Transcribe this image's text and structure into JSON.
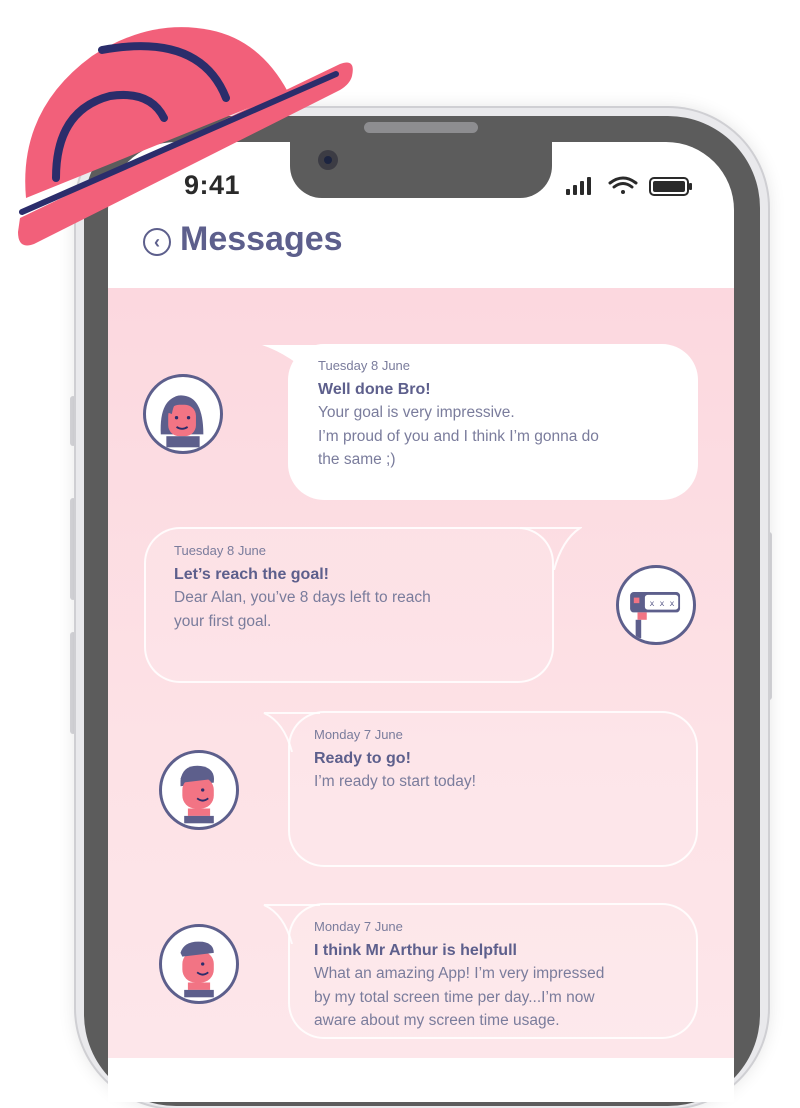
{
  "status_bar": {
    "time": "9:41"
  },
  "header": {
    "title": "Messages",
    "back_icon": "chevron-left-icon"
  },
  "colors": {
    "accent": "#5d5f8c",
    "background": "#fcd8df",
    "hat": "#f2607a",
    "hat_line": "#2b2d6b"
  },
  "messages": [
    {
      "date": "Tuesday 8 June",
      "title": "Well done Bro!",
      "text": "Your goal is very impressive.\nI’m proud of you and I think I’m gonna do\nthe same ;)",
      "avatar": "woman-avatar-icon"
    },
    {
      "date": "Tuesday 8 June",
      "title": "Let’s reach the goal!",
      "text": "Dear Alan, you’ve 8 days left to reach\n your first goal.",
      "avatar": "robot-avatar-icon"
    },
    {
      "date": "Monday 7 June",
      "title": "Ready to go!",
      "text": "I’m ready to start today!",
      "avatar": "man-avatar-icon"
    },
    {
      "date": "Monday 7 June",
      "title": "I think Mr Arthur is helpfull",
      "text": "What an amazing App! I’m very impressed\nby my total screen time per day...I’m now\naware about my screen time usage.",
      "avatar": "man-avatar-icon"
    }
  ]
}
